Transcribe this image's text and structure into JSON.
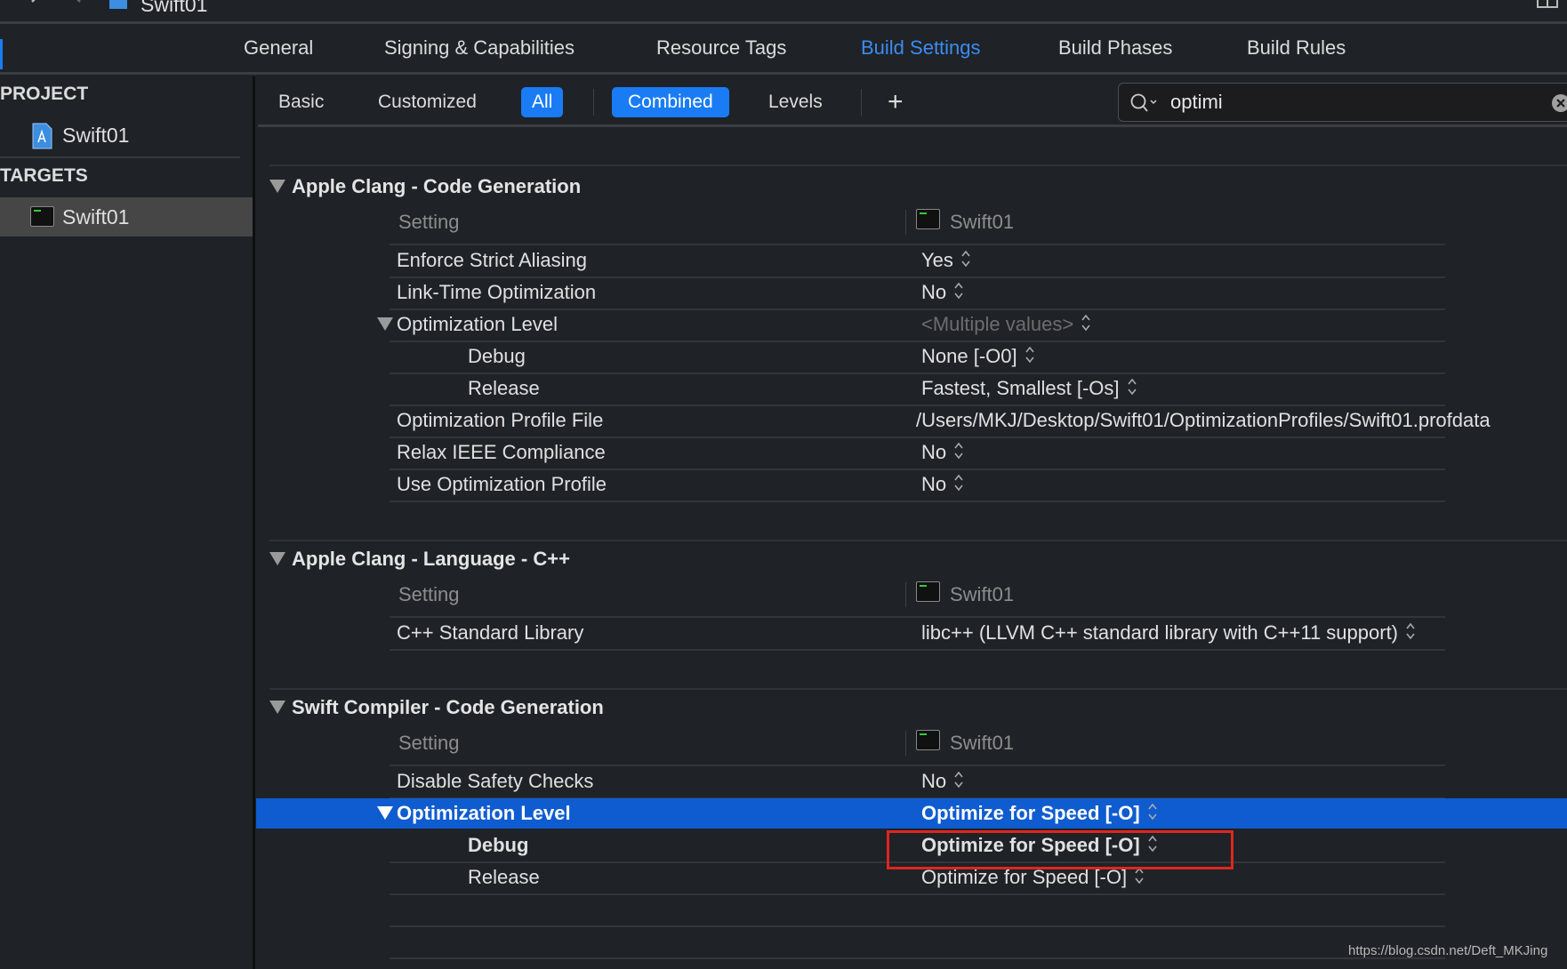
{
  "topbar": {
    "title": "Swift01"
  },
  "tabs": [
    {
      "label": "General",
      "active": false
    },
    {
      "label": "Signing & Capabilities",
      "active": false
    },
    {
      "label": "Resource Tags",
      "active": false
    },
    {
      "label": "Build Settings",
      "active": true
    },
    {
      "label": "Build Phases",
      "active": false
    },
    {
      "label": "Build Rules",
      "active": false
    }
  ],
  "sidebar": {
    "project_header": "PROJECT",
    "project_item": "Swift01",
    "targets_header": "TARGETS",
    "target_item": "Swift01"
  },
  "filterbar": {
    "basic": "Basic",
    "customized": "Customized",
    "all": "All",
    "combined": "Combined",
    "levels": "Levels",
    "add": "+"
  },
  "search": {
    "value": "optimi"
  },
  "accent_color": "#1a7cf5",
  "highlight_color": "#0f5cd0",
  "sections": [
    {
      "title": "Apple Clang - Code Generation",
      "setting_header": "Setting",
      "target_header": "Swift01",
      "rows": [
        {
          "name": "Enforce Strict Aliasing",
          "value": "Yes",
          "stepper": true
        },
        {
          "name": "Link-Time Optimization",
          "value": "No",
          "stepper": true
        },
        {
          "name": "Optimization Level",
          "value": "<Multiple values>",
          "stepper": true,
          "dimmed": true,
          "expanded": true,
          "children": [
            {
              "name": "Debug",
              "value": "None [-O0]",
              "stepper": true
            },
            {
              "name": "Release",
              "value": "Fastest, Smallest [-Os]",
              "stepper": true
            }
          ]
        },
        {
          "name": "Optimization Profile File",
          "value": "/Users/MKJ/Desktop/Swift01/OptimizationProfiles/Swift01.profdata",
          "stepper": false
        },
        {
          "name": "Relax IEEE Compliance",
          "value": "No",
          "stepper": true
        },
        {
          "name": "Use Optimization Profile",
          "value": "No",
          "stepper": true
        }
      ],
      "empty_rows": 0
    },
    {
      "title": "Apple Clang - Language - C++",
      "setting_header": "Setting",
      "target_header": "Swift01",
      "rows": [
        {
          "name": "C++ Standard Library",
          "value": "libc++ (LLVM C++ standard library with C++11 support)",
          "stepper": true
        }
      ],
      "empty_rows": 0
    },
    {
      "title": "Swift Compiler - Code Generation",
      "setting_header": "Setting",
      "target_header": "Swift01",
      "rows": [
        {
          "name": "Disable Safety Checks",
          "value": "No",
          "stepper": true
        },
        {
          "name": "Optimization Level",
          "value": "Optimize for Speed [-O]",
          "stepper": true,
          "bold": true,
          "selected": true,
          "expanded": true,
          "children": [
            {
              "name": "Debug",
              "value": "Optimize for Speed [-O]",
              "stepper": true,
              "bold": true,
              "annotated": true
            },
            {
              "name": "Release",
              "value": "Optimize for Speed [-O]",
              "stepper": true
            }
          ]
        }
      ],
      "empty_rows": 2
    }
  ],
  "annotation_color": "#e0261f",
  "watermark": "https://blog.csdn.net/Deft_MKJing"
}
